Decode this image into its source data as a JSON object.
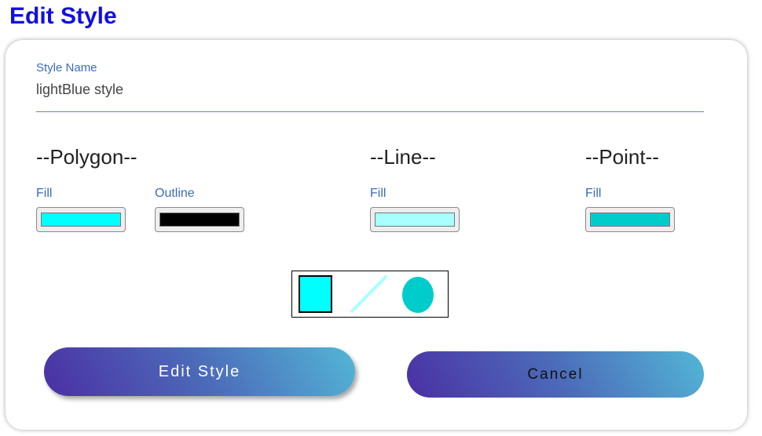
{
  "page": {
    "title": "Edit Style"
  },
  "form": {
    "style_name_label": "Style Name",
    "style_name_value": "lightBlue style"
  },
  "polygon": {
    "heading": "--Polygon--",
    "fill_label": "Fill",
    "fill_color": "#00ffff",
    "outline_label": "Outline",
    "outline_color": "#000000"
  },
  "line": {
    "heading": "--Line--",
    "fill_label": "Fill",
    "fill_color": "#a8ffff"
  },
  "point": {
    "heading": "--Point--",
    "fill_label": "Fill",
    "fill_color": "#00cccc"
  },
  "actions": {
    "edit_label": "Edit Style",
    "cancel_label": "Cancel"
  }
}
